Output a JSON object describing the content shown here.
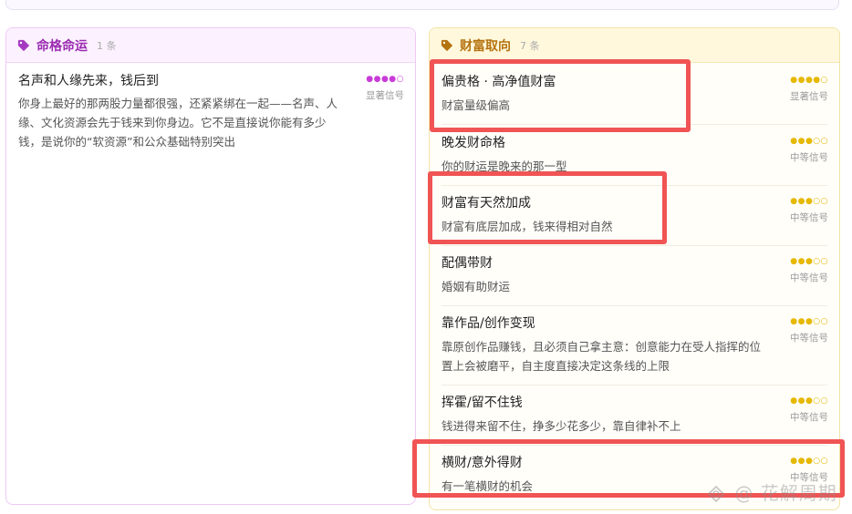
{
  "colors": {
    "left_accent": "#9a2bb0",
    "right_accent": "#b5730e",
    "left_dot": "#c93bd9",
    "right_dot": "#e6b800",
    "highlight": "#f05454"
  },
  "left_card": {
    "icon": "tag-icon",
    "title": "命格命运",
    "count": "1 条",
    "items": [
      {
        "title": "名声和人缘先来，钱后到",
        "desc": "你身上最好的那两股力量都很强，还紧紧绑在一起——名声、人缘、文化资源会先于钱来到你身边。它不是直接说你能有多少钱，是说你的“软资源”和公众基础特别突出",
        "dots": "●●●●○",
        "signal": "显著信号"
      }
    ]
  },
  "right_card": {
    "icon": "tag-icon",
    "title": "财富取向",
    "count": "7 条",
    "items": [
      {
        "title": "偏贵格 · 高净值财富",
        "desc": "财富量级偏高",
        "dots": "●●●●○",
        "signal": "显著信号"
      },
      {
        "title": "晚发财命格",
        "desc": "你的财运是晚来的那一型",
        "dots": "●●●○○",
        "signal": "中等信号"
      },
      {
        "title": "财富有天然加成",
        "desc": "财富有底层加成，钱来得相对自然",
        "dots": "●●●○○",
        "signal": "中等信号"
      },
      {
        "title": "配偶带财",
        "desc": "婚姻有助财运",
        "dots": "●●●○○",
        "signal": "中等信号"
      },
      {
        "title": "靠作品/创作变现",
        "desc": "靠原创作品赚钱，且必须自己拿主意：创意能力在受人指挥的位置上会被磨平，自主度直接决定这条线的上限",
        "dots": "●●●○○",
        "signal": "中等信号"
      },
      {
        "title": "挥霍/留不住钱",
        "desc": "钱进得来留不住，挣多少花多少，靠自律补不上",
        "dots": "●●●○○",
        "signal": "中等信号"
      },
      {
        "title": "横财/意外得财",
        "desc": "有一笔横财的机会",
        "dots": "●●●○○",
        "signal": "中等信号"
      }
    ]
  },
  "watermark": "花解周期"
}
